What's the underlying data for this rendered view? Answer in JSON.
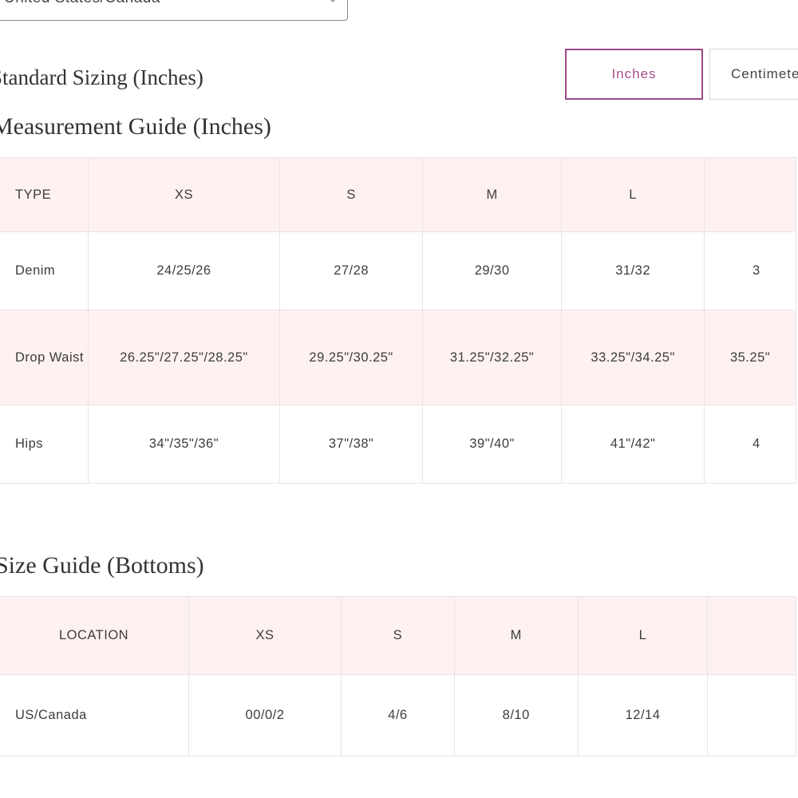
{
  "region_select": {
    "value": "United States/Canada"
  },
  "standard_sizing_title": "Standard Sizing (Inches)",
  "units": {
    "inches_label": "Inches",
    "centimeters_label": "Centimeters"
  },
  "measurement_guide": {
    "title": "Measurement Guide (Inches)",
    "headers": [
      "TYPE",
      "XS",
      "S",
      "M",
      "L",
      ""
    ],
    "rows": [
      {
        "label": "Denim",
        "cells": [
          "24/25/26",
          "27/28",
          "29/30",
          "31/32",
          "3"
        ]
      },
      {
        "label": "Drop Waist",
        "cells": [
          "26.25\"/27.25\"/28.25\"",
          "29.25\"/30.25\"",
          "31.25\"/32.25\"",
          "33.25\"/34.25\"",
          "35.25\""
        ]
      },
      {
        "label": "Hips",
        "cells": [
          "34\"/35\"/36\"",
          "37\"/38\"",
          "39\"/40\"",
          "41\"/42\"",
          "4"
        ]
      }
    ]
  },
  "size_guide": {
    "title": "Size Guide (Bottoms)",
    "headers": [
      "LOCATION",
      "XS",
      "S",
      "M",
      "L",
      ""
    ],
    "rows": [
      {
        "label": "US/Canada",
        "cells": [
          "00/0/2",
          "4/6",
          "8/10",
          "12/14",
          ""
        ]
      }
    ]
  }
}
